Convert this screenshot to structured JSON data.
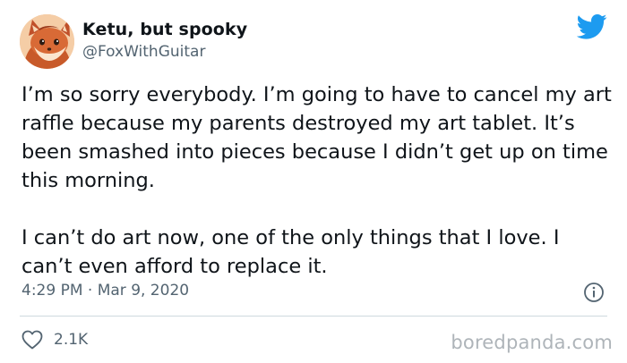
{
  "author": {
    "display_name": "Ketu, but spooky",
    "handle": "@FoxWithGuitar",
    "avatar_icon": "fox-avatar"
  },
  "tweet": {
    "paragraphs": [
      "I’m so sorry everybody. I’m going to have to cancel my art raffle because my parents destroyed my art tablet. It’s been smashed into pieces because I didn’t get up on time this morning.",
      "I can’t do art now, one of the only things that I love. I can’t even afford to replace it."
    ],
    "timestamp": "4:29 PM · Mar 9, 2020"
  },
  "actions": {
    "like_count": "2.1K",
    "like_icon": "heart-outline-icon",
    "info_icon": "info-icon"
  },
  "branding": {
    "platform_icon": "twitter-bird-icon",
    "platform_color": "#1d9bf0",
    "watermark": "boredpanda.com"
  },
  "colors": {
    "text": "#0f1419",
    "secondary": "#536471",
    "divider": "#cfd9de"
  }
}
